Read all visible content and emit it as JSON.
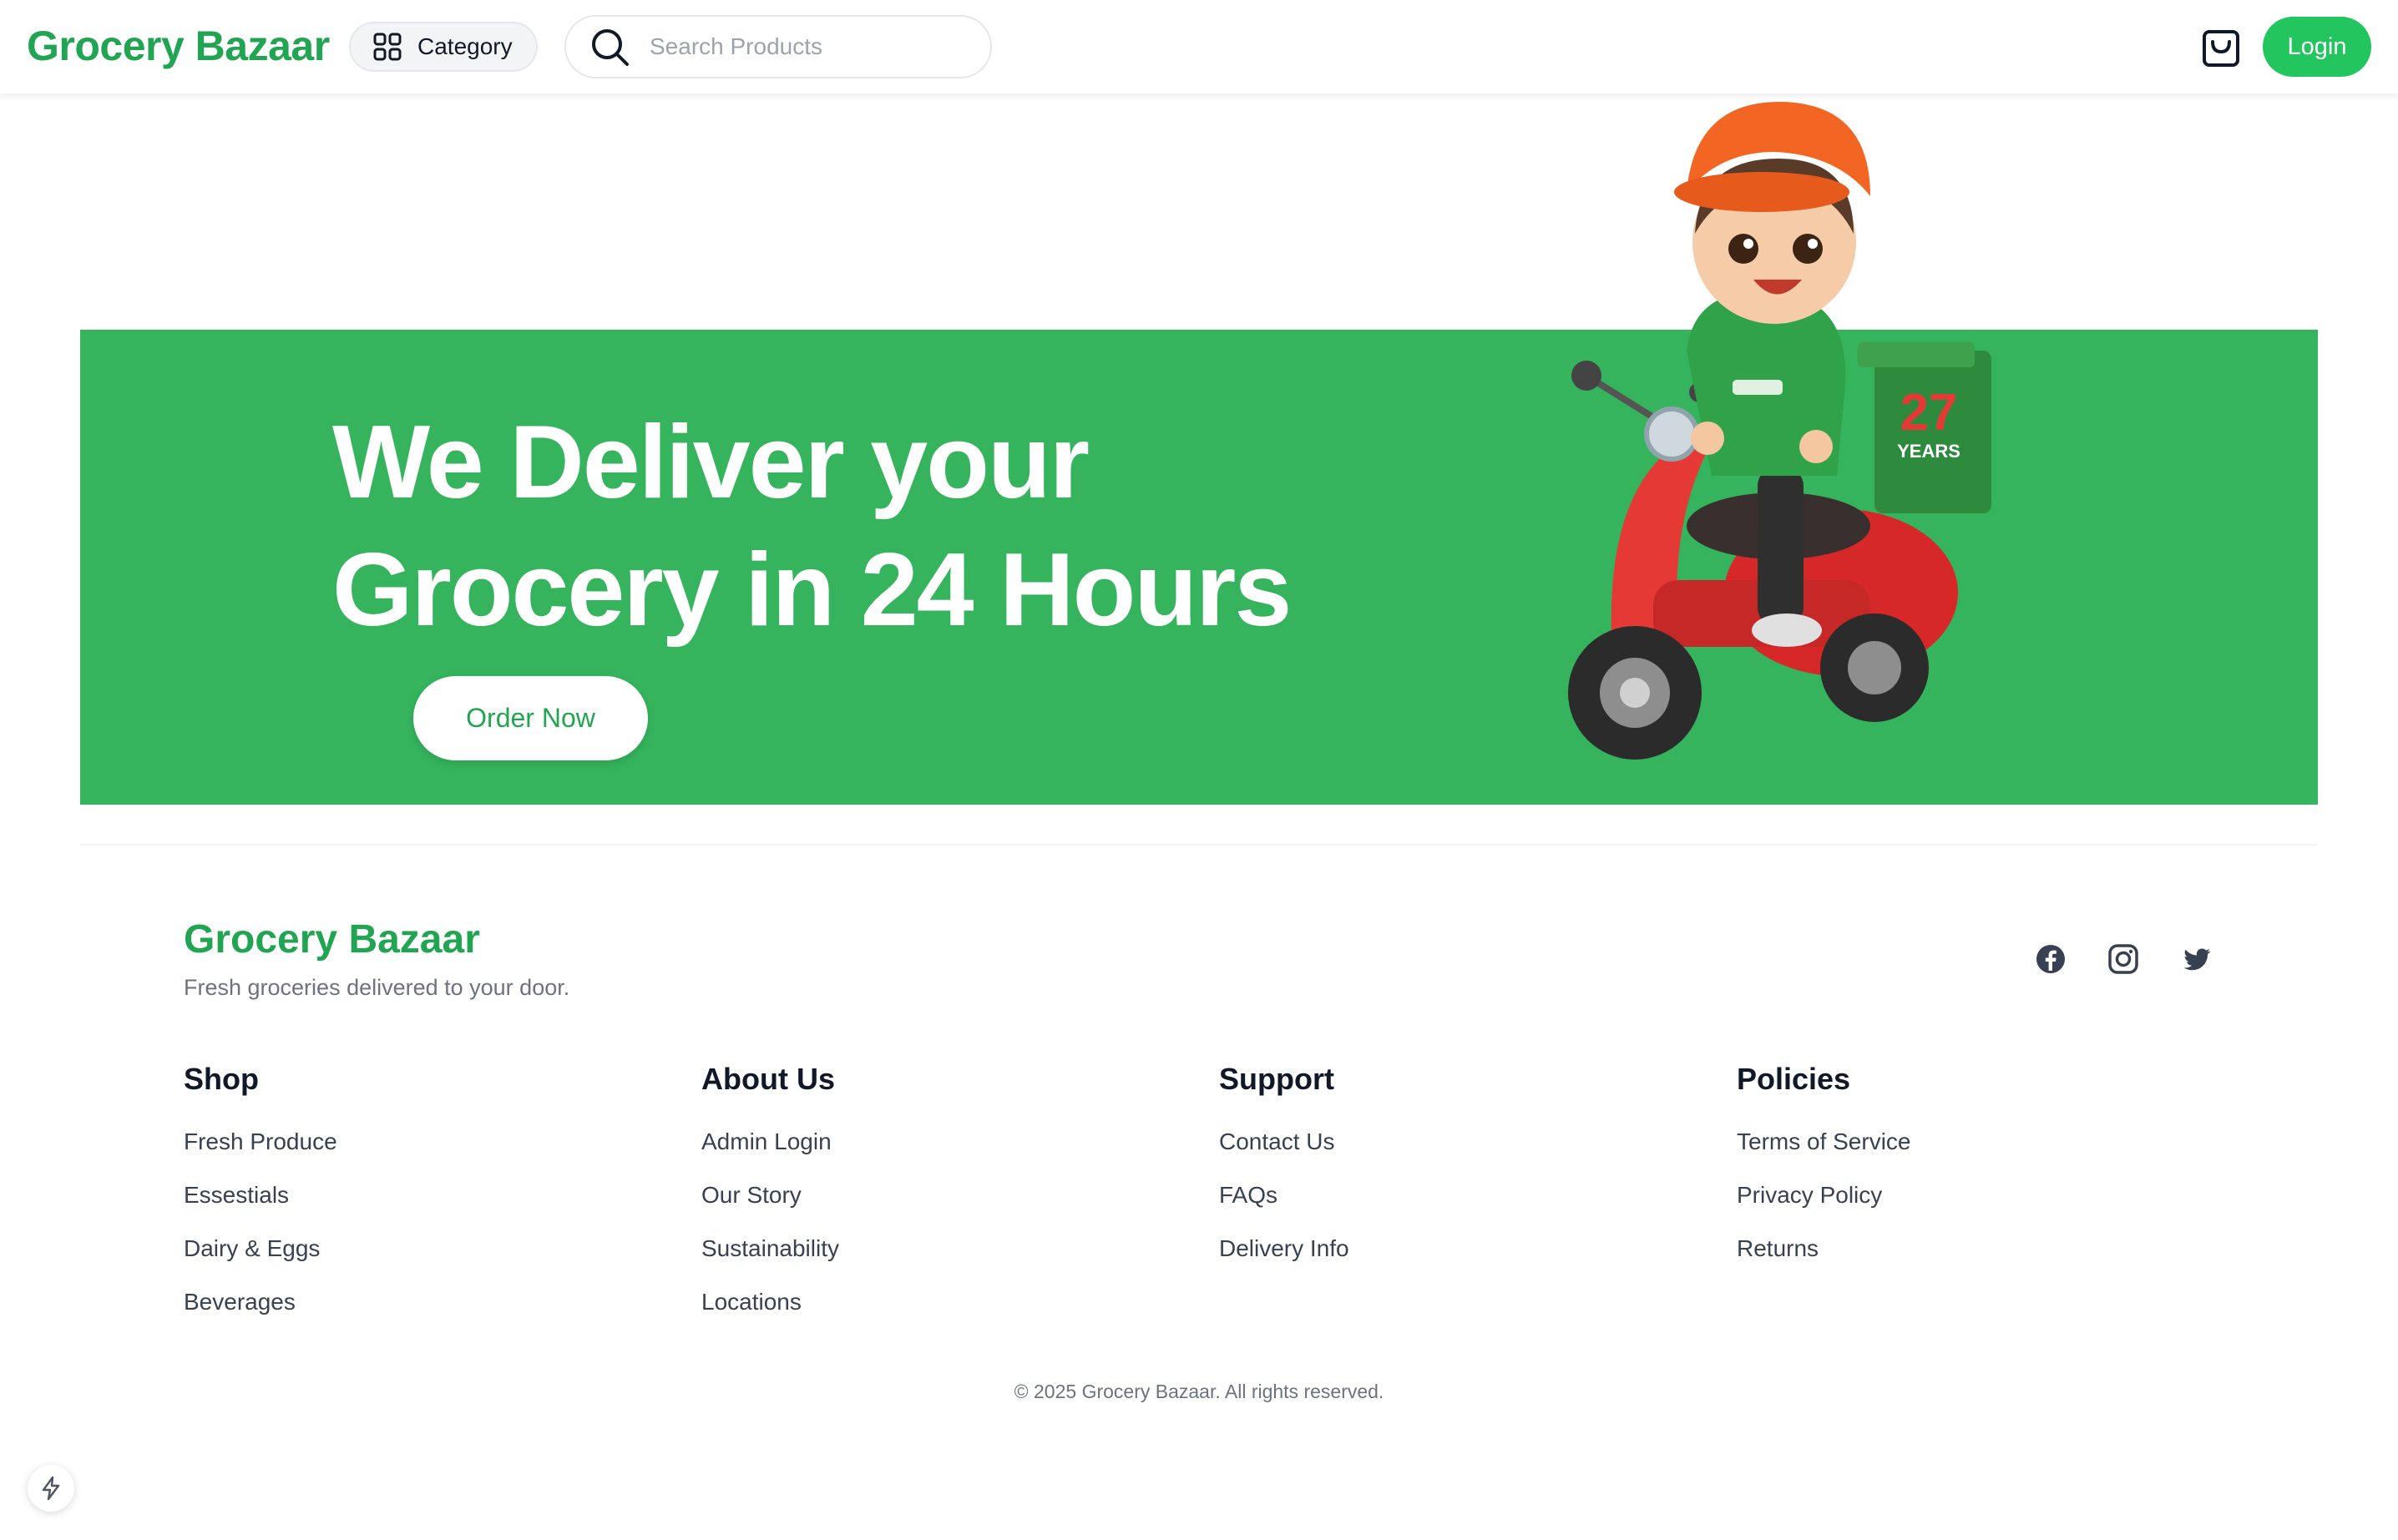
{
  "header": {
    "brand": "Grocery Bazaar",
    "category_label": "Category",
    "search_placeholder": "Search Products",
    "login_label": "Login"
  },
  "hero": {
    "title_line1": "We Deliver your",
    "title_line2": "Grocery in 24 Hours",
    "cta_label": "Order Now",
    "illustration_box_number": "27",
    "illustration_box_text": "YEARS"
  },
  "footer": {
    "brand": "Grocery Bazaar",
    "tagline": "Fresh groceries delivered to your door.",
    "social": [
      "facebook-icon",
      "instagram-icon",
      "twitter-icon"
    ],
    "columns": [
      {
        "title": "Shop",
        "links": [
          "Fresh Produce",
          "Essestials",
          "Dairy & Eggs",
          "Beverages"
        ]
      },
      {
        "title": "About Us",
        "links": [
          "Admin Login",
          "Our Story",
          "Sustainability",
          "Locations"
        ]
      },
      {
        "title": "Support",
        "links": [
          "Contact Us",
          "FAQs",
          "Delivery Info"
        ]
      },
      {
        "title": "Policies",
        "links": [
          "Terms of Service",
          "Privacy Policy",
          "Returns"
        ]
      }
    ],
    "copyright": "© 2025 Grocery Bazaar. All rights reserved."
  },
  "colors": {
    "brand_green": "#22a552",
    "hero_green": "#35b45d",
    "login_green": "#22c55e"
  }
}
